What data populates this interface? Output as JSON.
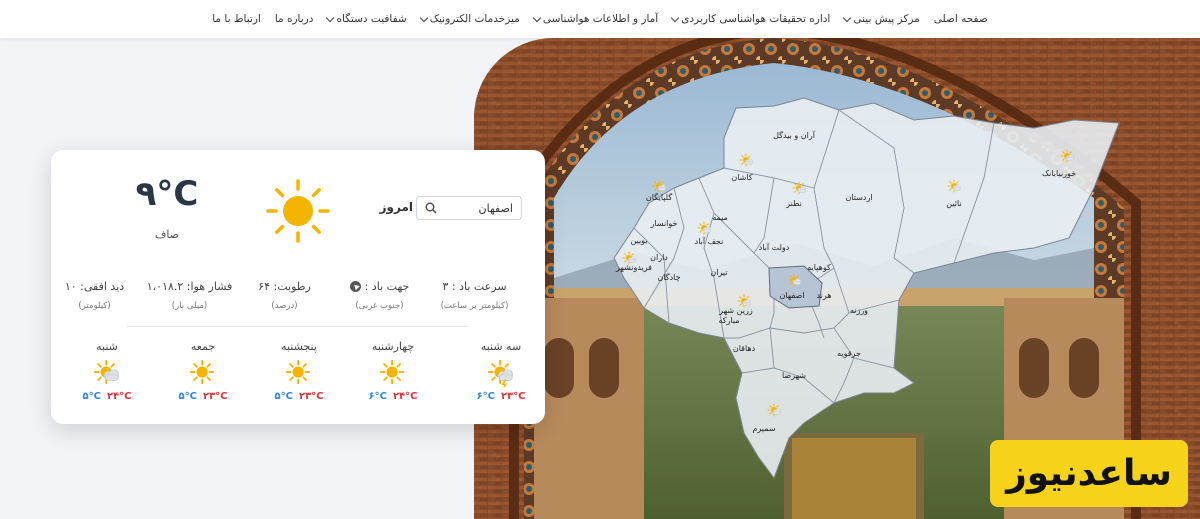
{
  "nav": {
    "items": [
      {
        "label": "صفحه اصلی",
        "dropdown": false
      },
      {
        "label": "مرکز پیش بینی",
        "dropdown": true
      },
      {
        "label": "اداره تحقیقات هواشناسی کاربردی",
        "dropdown": true
      },
      {
        "label": "آمار و اطلاعات هواشناسی",
        "dropdown": true
      },
      {
        "label": "میزخدمات الکترونیک",
        "dropdown": true
      },
      {
        "label": "شفافیت دستگاه",
        "dropdown": true
      },
      {
        "label": "درباره ما",
        "dropdown": false
      },
      {
        "label": "ارتباط با ما",
        "dropdown": false
      }
    ]
  },
  "weather": {
    "today_label": "امروز",
    "search_value": "اصفهان",
    "temperature": "۹°C",
    "condition": "صاف",
    "stats": [
      {
        "value": "سرعت باد : ۳",
        "unit": "(کیلومتر بر ساعت)"
      },
      {
        "value": "جهت باد :",
        "unit": "(جنوب غربی)"
      },
      {
        "value": "رطوبت: ۶۴",
        "unit": "(درصد)"
      },
      {
        "value": "فشار هوا: ۱،۰۱۸.۲",
        "unit": "(میلی بار)"
      },
      {
        "value": "دید افقی: ۱۰",
        "unit": "(کیلومتر)"
      }
    ],
    "forecast": [
      {
        "day": "سه شنبه",
        "icon": "sun-cloud-storm-icon",
        "low": "۶°C",
        "high": "۲۳°C"
      },
      {
        "day": "چهارشنبه",
        "icon": "sun-icon",
        "low": "۶°C",
        "high": "۲۴°C"
      },
      {
        "day": "پنجشنبه",
        "icon": "sun-icon",
        "low": "۵°C",
        "high": "۲۳°C"
      },
      {
        "day": "جمعه",
        "icon": "sun-icon",
        "low": "۵°C",
        "high": "۲۳°C"
      },
      {
        "day": "شنبه",
        "icon": "sun-cloud-icon",
        "low": "۵°C",
        "high": "۲۴°C"
      }
    ]
  },
  "map": {
    "cities": [
      "آران و بیدگل",
      "کاشان",
      "نطنز",
      "اردستان",
      "نائین",
      "خوربیابانک",
      "گلپایگان",
      "خوانسار",
      "بویین",
      "داران",
      "میمه",
      "نجف آباد",
      "دولت آباد",
      "فریدونشهر",
      "چادگان",
      "تیران",
      "کوهپایه",
      "اصفهان",
      "هرند",
      "ورزنه",
      "زرین شهر",
      "مبارکه",
      "دهاقان",
      "جرقویه",
      "شهرضا",
      "سمیرم"
    ]
  },
  "logo": {
    "text": "ساعدنیوز"
  },
  "colors": {
    "accent_sun": "#f5b400",
    "temp_low": "#2f87d6",
    "temp_high": "#e0323e",
    "logo_bg": "#f7d21a"
  }
}
